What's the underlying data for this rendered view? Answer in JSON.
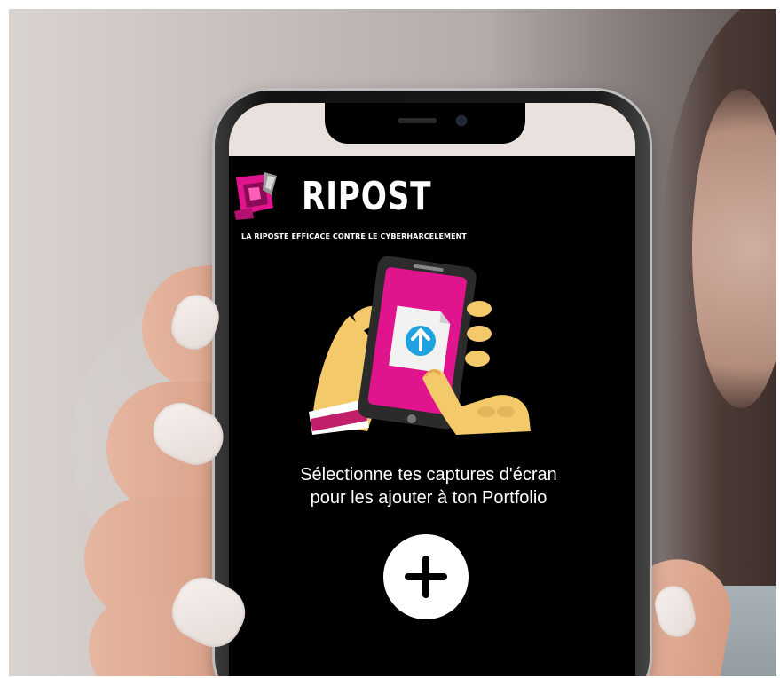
{
  "app": {
    "name": "RIPOST",
    "tagline": "LA RIPOSTE EFFICACE CONTRE LE CYBERHARCELEMENT",
    "logo_icon": "ripost-logo-icon"
  },
  "main": {
    "illustration_icon": "hand-holding-phone-upload-icon",
    "message_line1": "Sélectionne tes captures d'écran",
    "message_line2": "pour les ajouter à ton Portfolio",
    "add_button_icon": "plus-icon"
  },
  "colors": {
    "screen_background": "#000000",
    "accent_magenta": "#e0148c",
    "upload_blue": "#1fa3e0",
    "skin": "#f3c96a",
    "text": "#ffffff"
  }
}
